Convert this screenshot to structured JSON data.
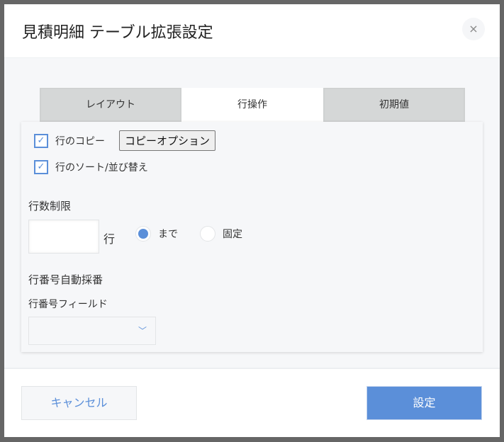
{
  "dialog": {
    "title": "見積明細 テーブル拡張設定",
    "close": "×"
  },
  "tabs": [
    {
      "label": "レイアウト"
    },
    {
      "label": "行操作"
    },
    {
      "label": "初期値"
    }
  ],
  "options": {
    "copy_label": "行のコピー",
    "copy_checked": true,
    "copy_option_button": "コピーオプション",
    "sort_label": "行のソート/並び替え",
    "sort_checked": true
  },
  "row_limit": {
    "heading": "行数制限",
    "value": "",
    "unit": "行",
    "radio_options": [
      {
        "label": "まで",
        "selected": true
      },
      {
        "label": "固定",
        "selected": false
      }
    ]
  },
  "numbering": {
    "heading": "行番号自動採番",
    "field_label": "行番号フィールド",
    "field_value": ""
  },
  "footer": {
    "cancel": "キャンセル",
    "submit": "設定"
  },
  "colors": {
    "accent": "#5b8fd9"
  }
}
